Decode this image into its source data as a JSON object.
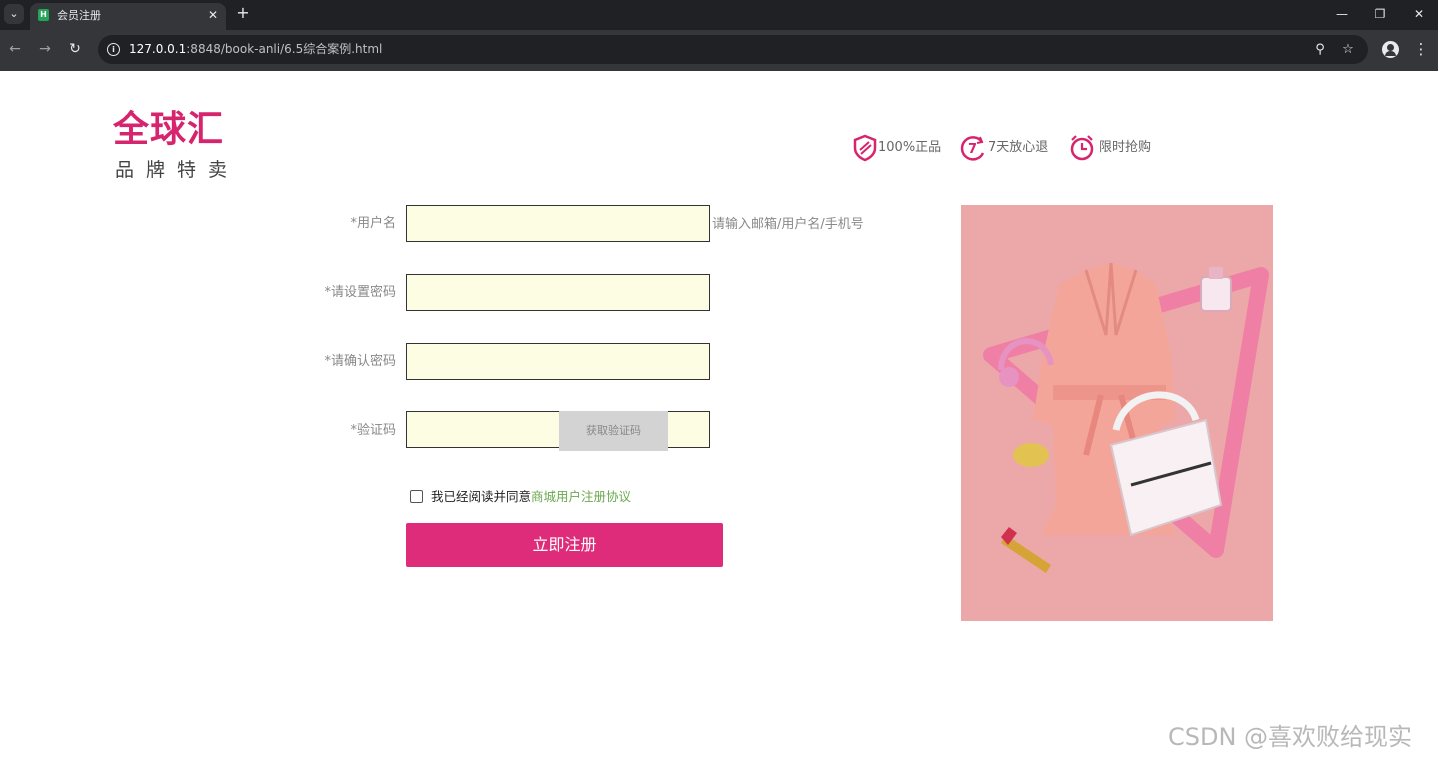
{
  "browser": {
    "tab_title": "会员注册",
    "url_host": "127.0.0.1",
    "url_rest": ":8848/book-anli/6.5综合案例.html"
  },
  "logo": {
    "main": "全球汇",
    "sub": "品牌特卖"
  },
  "promises": [
    {
      "label": "100%正品"
    },
    {
      "label": "7天放心退"
    },
    {
      "label": "限时抢购"
    }
  ],
  "form": {
    "username_label": "*用户名",
    "username_hint": "请输入邮箱/用户名/手机号",
    "password_label": "*请设置密码",
    "confirm_label": "*请确认密码",
    "code_label": "*验证码",
    "get_code_button": "获取验证码",
    "agree_text": "我已经阅读并同意",
    "agree_link": "商城用户注册协议",
    "submit_label": "立即注册"
  },
  "colors": {
    "brand_pink": "#de2c7b",
    "input_bg": "#fdfde4",
    "banner_bg": "#eca8a8",
    "link_green": "#6aa84f"
  },
  "watermark": "CSDN @喜欢败给现实"
}
